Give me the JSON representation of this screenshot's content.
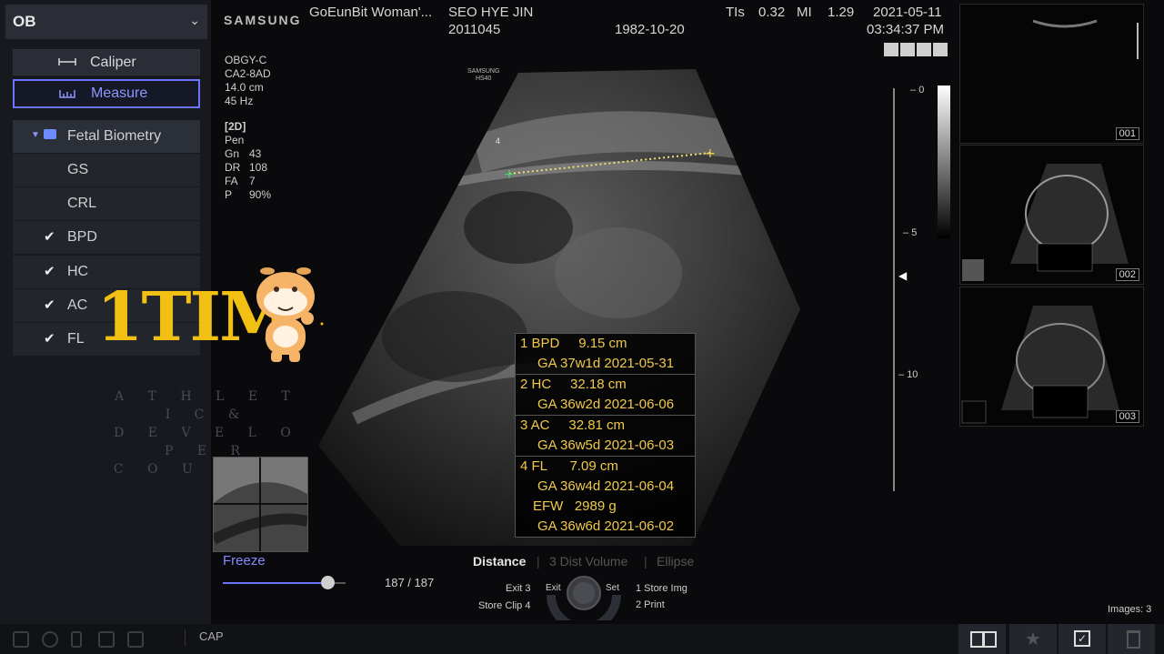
{
  "left_panel": {
    "preset": "OB",
    "tools": [
      {
        "label": "Caliper",
        "icon": "caliper-icon"
      },
      {
        "label": "Measure",
        "icon": "measure-icon"
      }
    ],
    "group": {
      "label": "Fetal Biometry"
    },
    "items": [
      {
        "label": "GS",
        "checked": false
      },
      {
        "label": "CRL",
        "checked": false
      },
      {
        "label": "BPD",
        "checked": true
      },
      {
        "label": "HC",
        "checked": true
      },
      {
        "label": "AC",
        "checked": true
      },
      {
        "label": "FL",
        "checked": true
      }
    ],
    "check_glyph": "✔"
  },
  "watermark": {
    "logo": "1TIM",
    "tagline": [
      "A T H L E T I C &",
      "D E V E L O P E R",
      "C O U P L E"
    ]
  },
  "header": {
    "brand": "SAMSUNG",
    "hospital": "GoEunBit Woman'...",
    "patient_name": "SEO HYE JIN",
    "patient_id": "2011045",
    "dob": "1982-10-20",
    "tis_label": "TIs",
    "tis_value": "0.32",
    "mi_label": "MI",
    "mi_value": "1.29",
    "date": "2021-05-11",
    "time": "03:34:37 PM"
  },
  "scan_params": {
    "app": "OBGY-C",
    "probe": "CA2-8AD",
    "depth": "14.0 cm",
    "freq": "45 Hz",
    "mode": "[2D]",
    "preset": "Pen",
    "gn_label": "Gn",
    "gn": "43",
    "dr_label": "DR",
    "dr": "108",
    "fa_label": "FA",
    "fa": "7",
    "p_label": "P",
    "p": "90%"
  },
  "image_labels": {
    "probe_brand": "SAMSUNG",
    "probe_model": "HS40",
    "caliper_index": "4"
  },
  "depth_scale": {
    "ticks": [
      "0",
      "5",
      "10"
    ]
  },
  "results": [
    {
      "label": "1 BPD     9.15 cm",
      "ga": "GA 37w1d 2021-05-31"
    },
    {
      "label": "2 HC     32.18 cm",
      "ga": "GA 36w2d 2021-06-06"
    },
    {
      "label": "3 AC     32.81 cm",
      "ga": "GA 36w5d 2021-06-03"
    },
    {
      "label": "4 FL      7.09 cm",
      "ga": "GA 36w4d 2021-06-04"
    }
  ],
  "efw": {
    "label": "EFW   2989 g",
    "ga": "GA 36w6d 2021-06-02"
  },
  "thumbnails": [
    "001",
    "002",
    "003"
  ],
  "playback": {
    "freeze_label": "Freeze",
    "frame": "187 / 187",
    "progress": 0.85
  },
  "mode_tabs": [
    {
      "label": "Distance",
      "active": true
    },
    {
      "label": "3 Dist Volume",
      "active": false
    },
    {
      "label": "Ellipse",
      "active": false
    }
  ],
  "knob": {
    "exit3": "Exit 3",
    "store_clip": "Store Clip 4",
    "exit": "Exit",
    "set": "Set",
    "store_img": "1 Store Img",
    "print": "2 Print"
  },
  "images_count": "Images: 3",
  "status": {
    "cap": "CAP"
  },
  "colors": {
    "accent": "#6b74ff",
    "measurement": "#f1ca4a",
    "logo": "#f2c012"
  }
}
